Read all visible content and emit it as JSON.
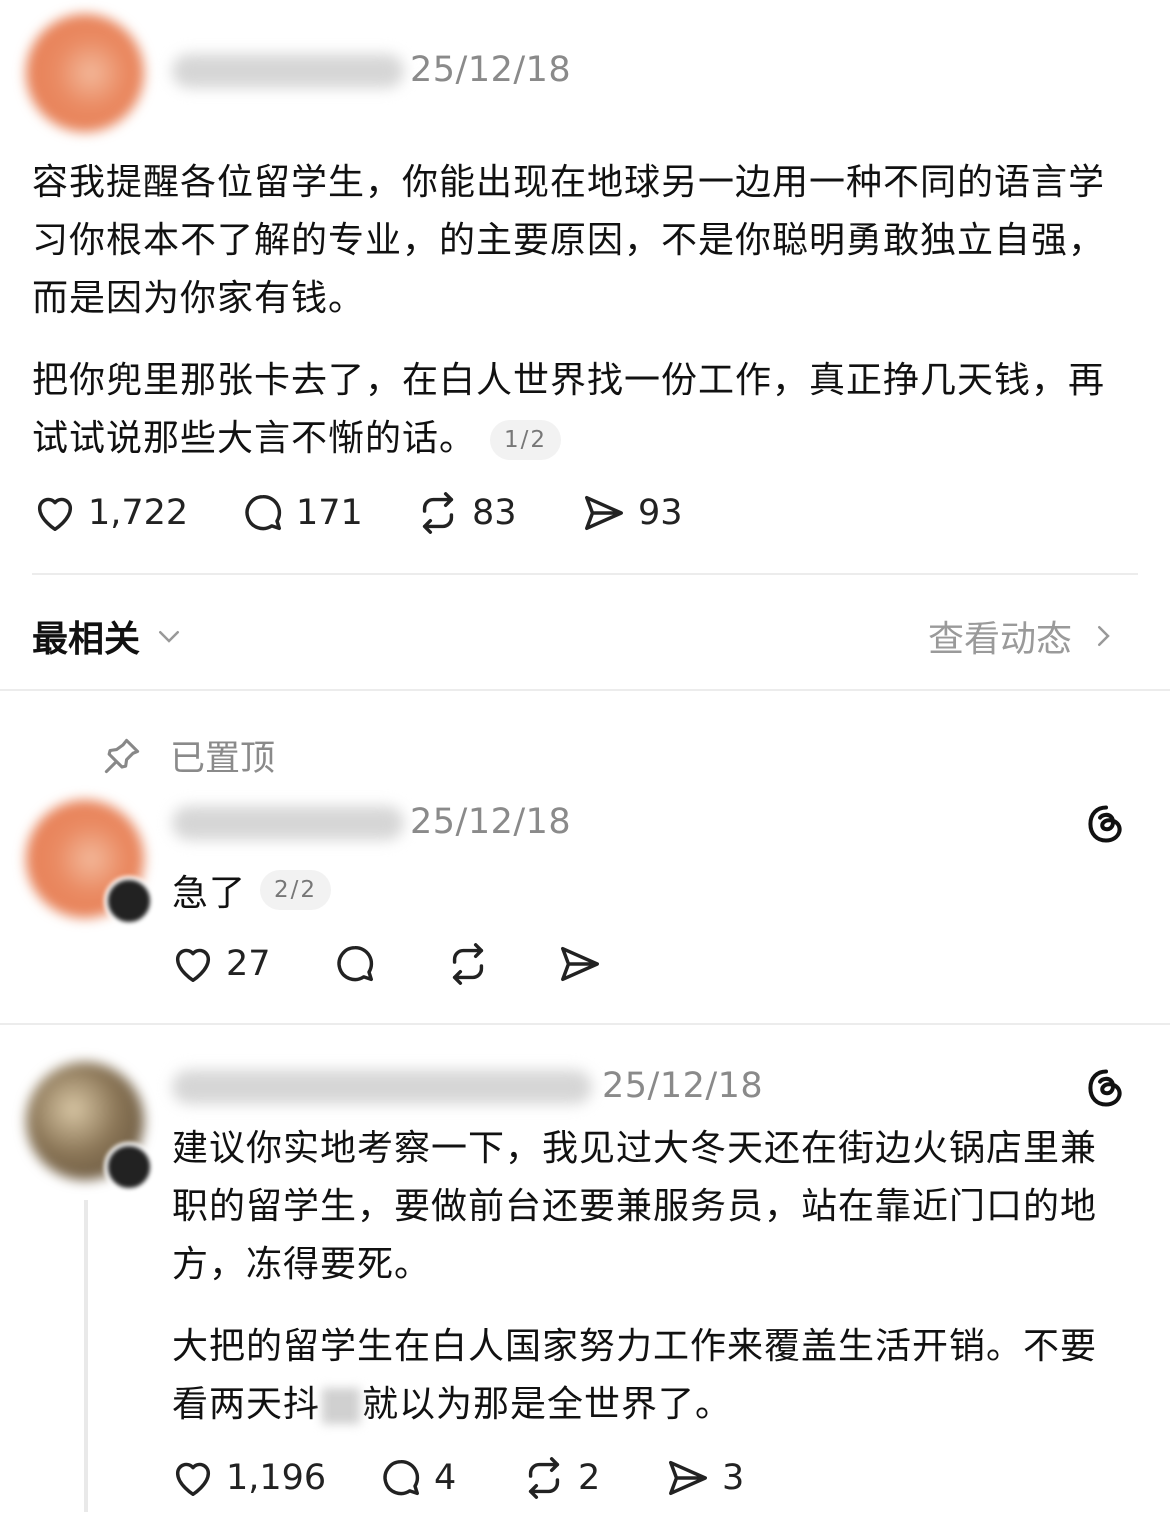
{
  "post": {
    "date": "25/12/18",
    "paragraph1": "容我提醒各位留学生，你能出现在地球另一边用一种不同的语言学习你根本不了解的专业，的主要原因，不是你聪明勇敢独立自强，而是因为你家有钱。",
    "paragraph2": "把你兜里那张卡去了，在白人世界找一份工作，真正挣几天钱，再试试说那些大言不惭的话。",
    "page_pill": "1/2",
    "stats": {
      "likes": "1,722",
      "comments": "171",
      "reposts": "83",
      "shares": "93"
    }
  },
  "sort_bar": {
    "sort_label": "最相关",
    "activity_link": "查看动态"
  },
  "pinned_label": "已置顶",
  "reply1": {
    "date": "25/12/18",
    "text": "急了",
    "page_pill": "2/2",
    "stats": {
      "likes": "27"
    }
  },
  "reply2": {
    "date": "25/12/18",
    "paragraph1": "建议你实地考察一下，我见过大冬天还在街边火锅店里兼职的留学生，要做前台还要兼服务员，站在靠近门口的地方，冻得要死。",
    "paragraph2a": "大把的留学生在白人国家努力工作来覆盖生活开销。不要看两天抖",
    "paragraph2b": "就以为那是全世界了。",
    "stats": {
      "likes": "1,196",
      "comments": "4",
      "reposts": "2",
      "shares": "3"
    }
  },
  "icons": {
    "like": "heart-icon",
    "comment": "comment-bubble-icon",
    "repost": "repost-icon",
    "share": "send-icon",
    "pin": "pin-icon",
    "chevron": "chevron-down-icon",
    "arrow": "chevron-right-icon",
    "threads": "threads-logo-icon"
  },
  "colors": {
    "avatar_orange": "#ea8a62",
    "muted": "#8a8a8a",
    "divider": "#ececec"
  }
}
